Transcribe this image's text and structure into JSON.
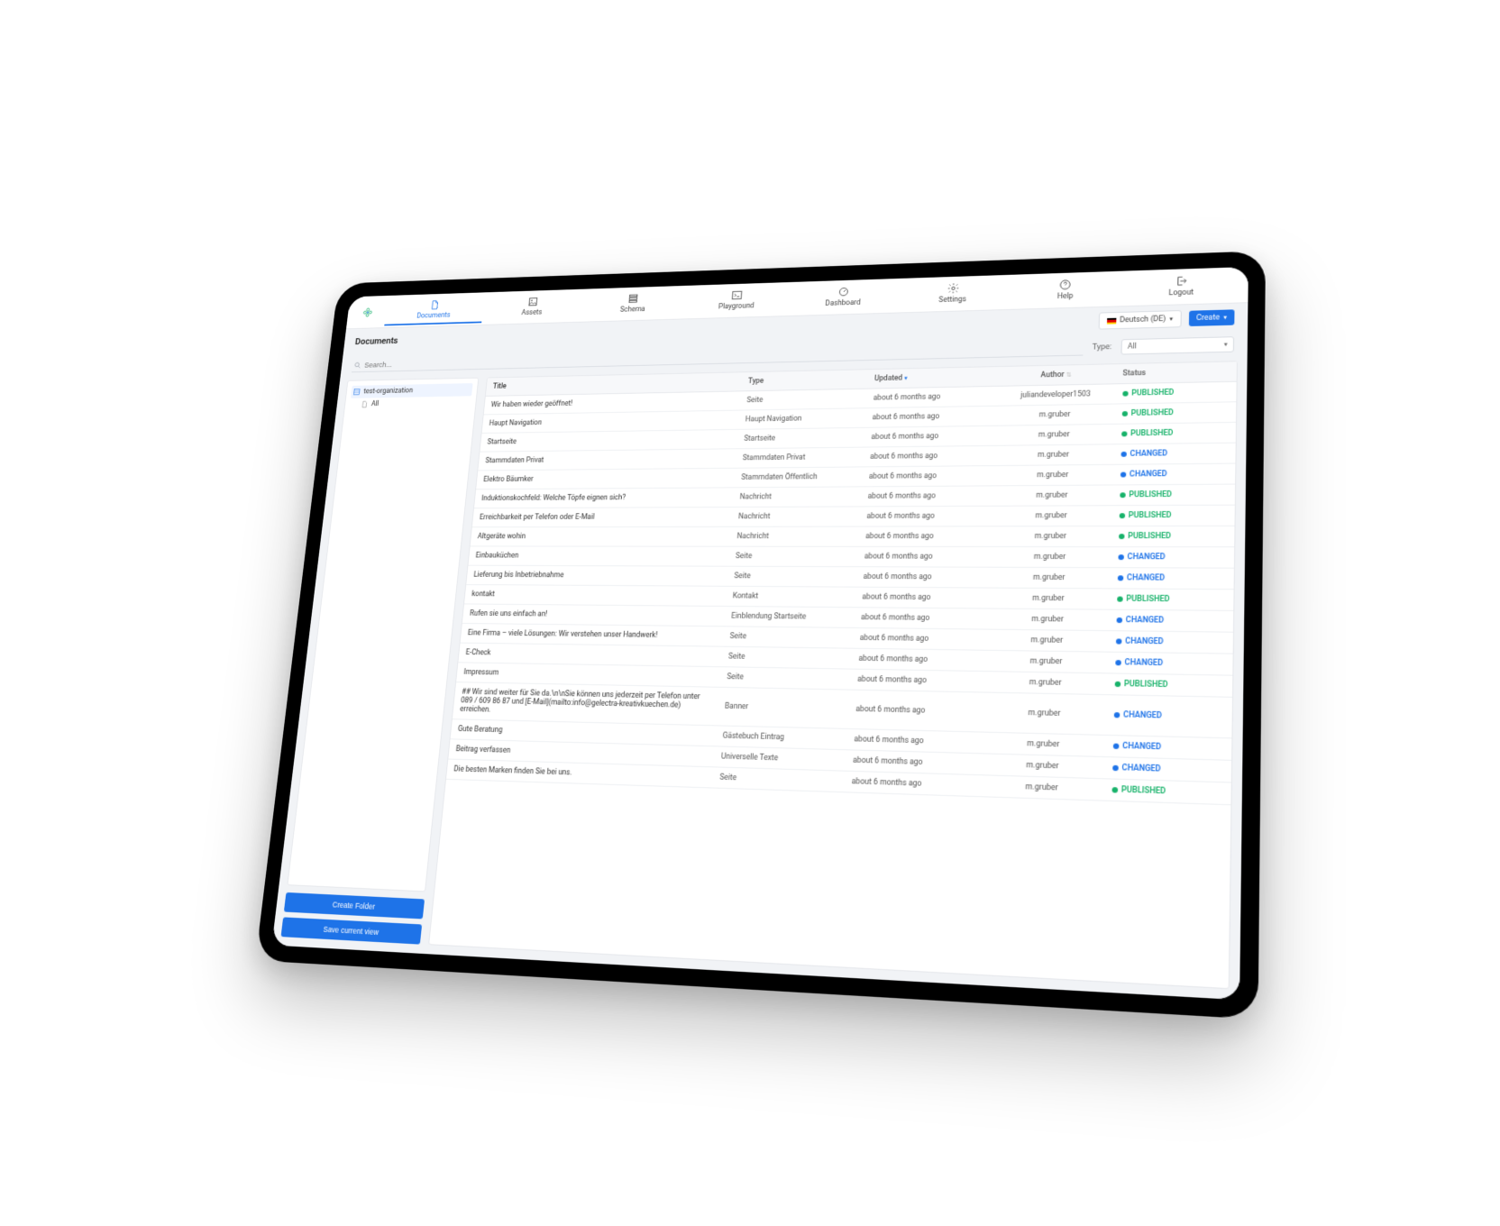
{
  "nav": {
    "items": [
      {
        "label": "Documents",
        "active": true
      },
      {
        "label": "Assets"
      },
      {
        "label": "Schema"
      },
      {
        "label": "Playground"
      },
      {
        "label": "Dashboard"
      },
      {
        "label": "Settings"
      },
      {
        "label": "Help"
      },
      {
        "label": "Logout"
      }
    ]
  },
  "toolbar": {
    "title": "Documents",
    "language": "Deutsch (DE)",
    "create": "Create"
  },
  "search": {
    "placeholder": "Search...",
    "type_label": "Type:",
    "type_value": "All"
  },
  "sidebar": {
    "org": "test-organization",
    "all": "All",
    "create_folder": "Create Folder",
    "save_view": "Save current view"
  },
  "table": {
    "headers": {
      "title": "Title",
      "type": "Type",
      "updated": "Updated",
      "author": "Author",
      "status": "Status"
    },
    "rows": [
      {
        "title": "Wir haben wieder geöffnet!",
        "type": "Seite",
        "updated": "about 6 months ago",
        "author": "juliandeveloper1503",
        "status": "PUBLISHED"
      },
      {
        "title": "Haupt Navigation",
        "type": "Haupt Navigation",
        "updated": "about 6 months ago",
        "author": "m.gruber",
        "status": "PUBLISHED"
      },
      {
        "title": "Startseite",
        "type": "Startseite",
        "updated": "about 6 months ago",
        "author": "m.gruber",
        "status": "PUBLISHED"
      },
      {
        "title": "Stammdaten Privat",
        "type": "Stammdaten Privat",
        "updated": "about 6 months ago",
        "author": "m.gruber",
        "status": "CHANGED"
      },
      {
        "title": "Elektro Bäumker",
        "type": "Stammdaten Öffentlich",
        "updated": "about 6 months ago",
        "author": "m.gruber",
        "status": "CHANGED"
      },
      {
        "title": "Induktionskochfeld: Welche Töpfe eignen sich?",
        "type": "Nachricht",
        "updated": "about 6 months ago",
        "author": "m.gruber",
        "status": "PUBLISHED"
      },
      {
        "title": "Erreichbarkeit per Telefon oder E-Mail",
        "type": "Nachricht",
        "updated": "about 6 months ago",
        "author": "m.gruber",
        "status": "PUBLISHED"
      },
      {
        "title": "Altgeräte wohin",
        "type": "Nachricht",
        "updated": "about 6 months ago",
        "author": "m.gruber",
        "status": "PUBLISHED"
      },
      {
        "title": "Einbauküchen",
        "type": "Seite",
        "updated": "about 6 months ago",
        "author": "m.gruber",
        "status": "CHANGED"
      },
      {
        "title": "Lieferung bis Inbetriebnahme",
        "type": "Seite",
        "updated": "about 6 months ago",
        "author": "m.gruber",
        "status": "CHANGED"
      },
      {
        "title": "kontakt",
        "type": "Kontakt",
        "updated": "about 6 months ago",
        "author": "m.gruber",
        "status": "PUBLISHED"
      },
      {
        "title": "Rufen sie uns einfach an!",
        "type": "Einblendung Startseite",
        "updated": "about 6 months ago",
        "author": "m.gruber",
        "status": "CHANGED"
      },
      {
        "title": "Eine Firma – viele Lösungen: Wir verstehen unser Handwerk!",
        "type": "Seite",
        "updated": "about 6 months ago",
        "author": "m.gruber",
        "status": "CHANGED"
      },
      {
        "title": "E-Check",
        "type": "Seite",
        "updated": "about 6 months ago",
        "author": "m.gruber",
        "status": "CHANGED"
      },
      {
        "title": "Impressum",
        "type": "Seite",
        "updated": "about 6 months ago",
        "author": "m.gruber",
        "status": "PUBLISHED"
      },
      {
        "title": "## Wir sind weiter für Sie da.\\n\\nSie können uns jederzeit per Telefon unter 089 / 609 86 87 und [E-Mail](mailto:info@gelectra-kreativkuechen.de) erreichen.",
        "type": "Banner",
        "updated": "about 6 months ago",
        "author": "m.gruber",
        "status": "CHANGED"
      },
      {
        "title": "Gute Beratung",
        "type": "Gästebuch Eintrag",
        "updated": "about 6 months ago",
        "author": "m.gruber",
        "status": "CHANGED"
      },
      {
        "title": "Beitrag verfassen",
        "type": "Universelle Texte",
        "updated": "about 6 months ago",
        "author": "m.gruber",
        "status": "CHANGED"
      },
      {
        "title": "Die besten Marken finden Sie bei uns.",
        "type": "Seite",
        "updated": "about 6 months ago",
        "author": "m.gruber",
        "status": "PUBLISHED"
      }
    ]
  }
}
